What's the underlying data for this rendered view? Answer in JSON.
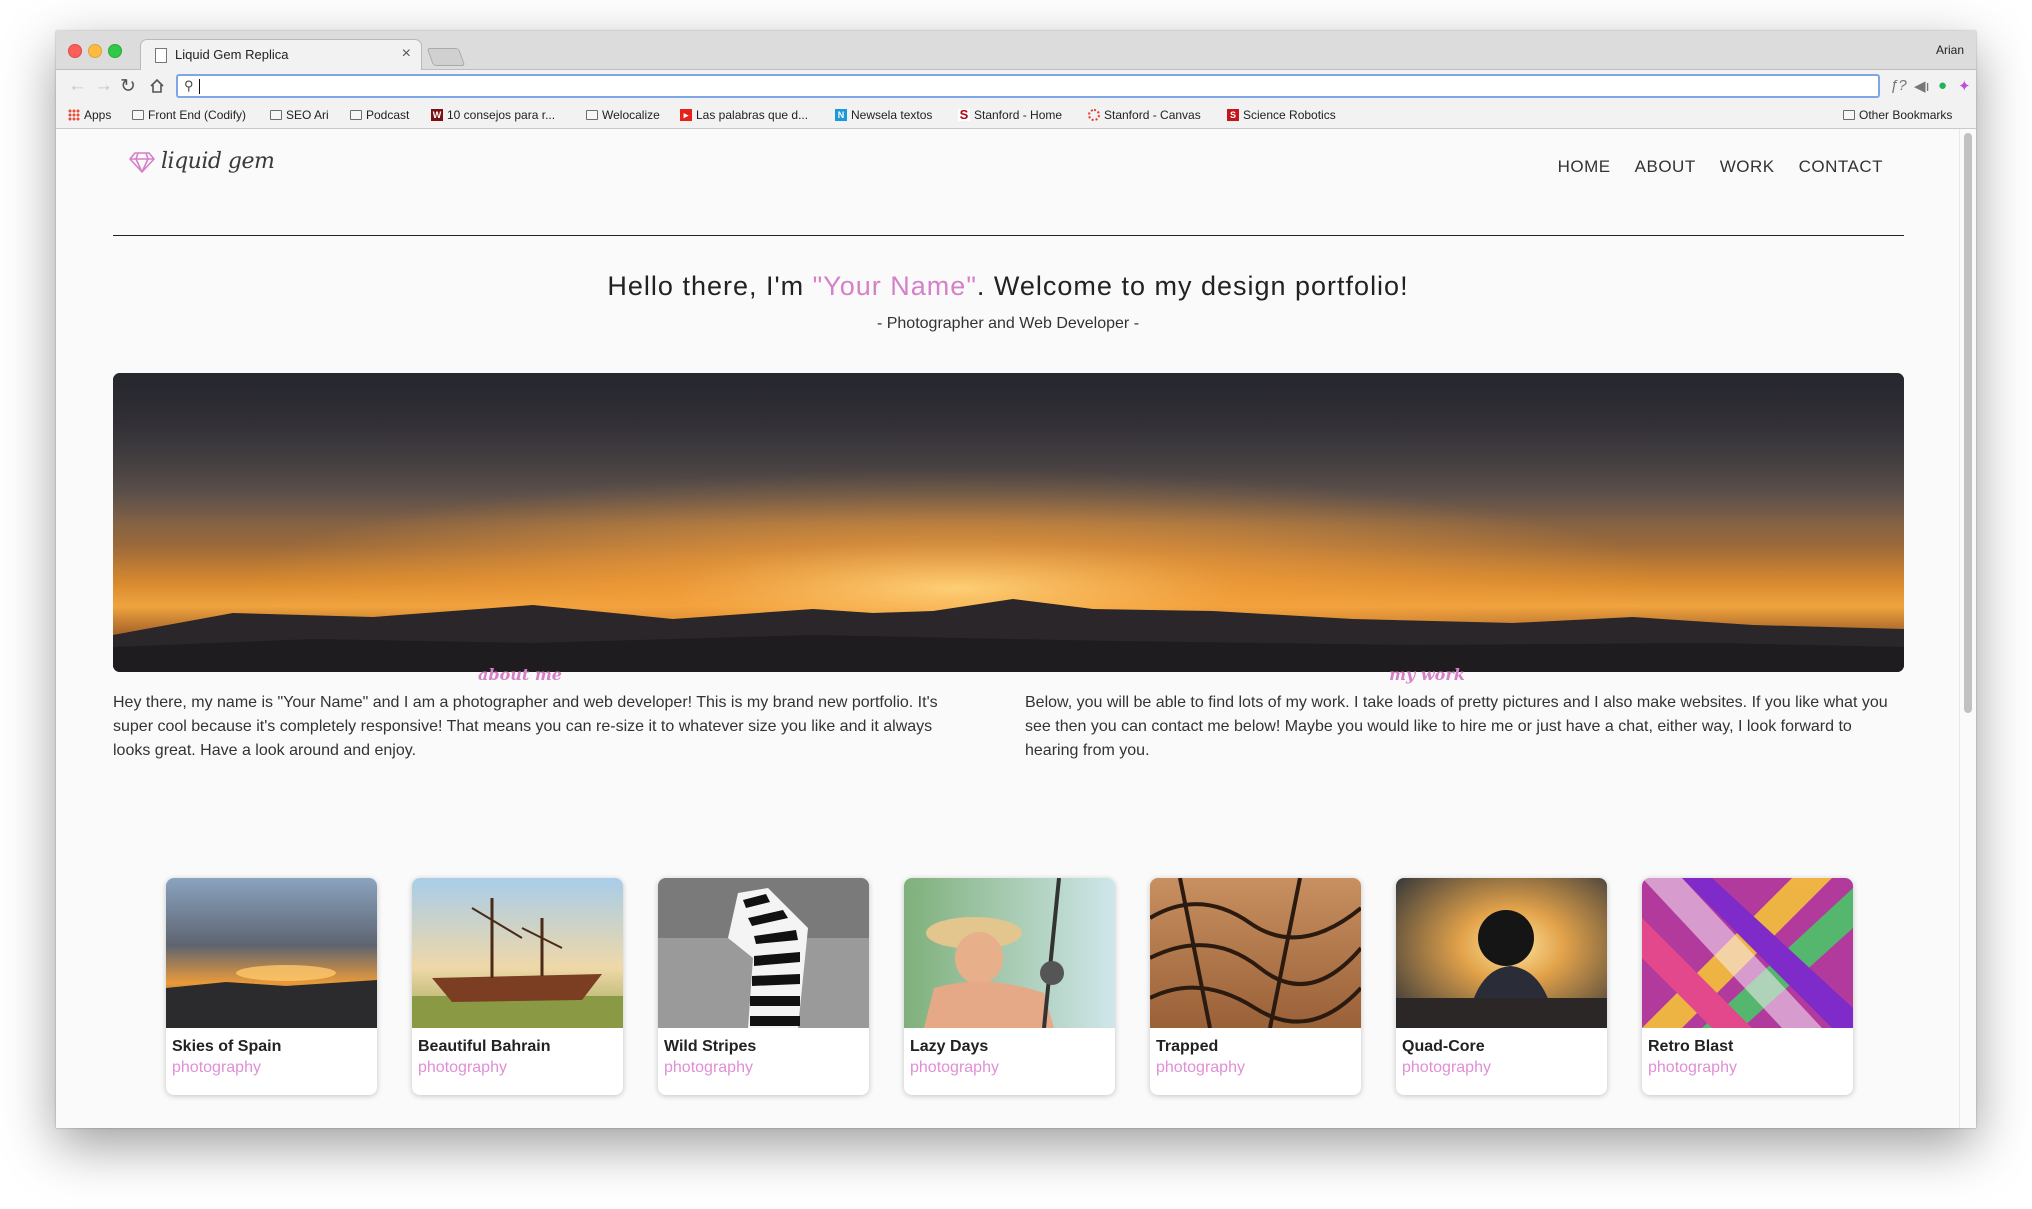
{
  "browser": {
    "tab_title": "Liquid Gem Replica",
    "tab_close": "×",
    "user": "Arian",
    "address_value": "",
    "bookmarks": [
      {
        "label": "Apps",
        "icon": "apps-grid-icon"
      },
      {
        "label": "Front End (Codify)",
        "icon": "folder-icon"
      },
      {
        "label": "SEO Ari",
        "icon": "folder-icon"
      },
      {
        "label": "Podcast",
        "icon": "folder-icon"
      },
      {
        "label": "10 consejos para r...",
        "icon": "w-site-icon"
      },
      {
        "label": "Welocalize",
        "icon": "folder-icon"
      },
      {
        "label": "Las palabras que d...",
        "icon": "youtube-icon"
      },
      {
        "label": "Newsela textos",
        "icon": "newsela-icon"
      },
      {
        "label": "Stanford - Home",
        "icon": "stanford-icon"
      },
      {
        "label": "Stanford - Canvas",
        "icon": "canvas-icon"
      },
      {
        "label": "Science Robotics",
        "icon": "science-icon"
      }
    ],
    "other_bookmarks": "Other Bookmarks"
  },
  "site": {
    "logo": "liquid gem",
    "nav": [
      "HOME",
      "ABOUT",
      "WORK",
      "CONTACT"
    ],
    "hero": {
      "prefix": "Hello there, I'm ",
      "name": "\"Your Name\"",
      "suffix": ". Welcome to my design portfolio!",
      "subtitle": "- Photographer and Web Developer -"
    },
    "about": {
      "title": "about me",
      "text": "Hey there, my name is \"Your Name\" and I am a photographer and web developer! This is my brand new portfolio. It's super cool because it's completely responsive! That means you can re-size it to whatever size you like and it always looks great. Have a look around and enjoy."
    },
    "work": {
      "title": "my work",
      "text": "Below, you will be able to find lots of my work. I take loads of pretty pictures and I also make websites. If you like what you see then you can contact me below! Maybe you would like to hire me or just have a chat, either way, I look forward to hearing from you."
    },
    "portfolio": [
      {
        "title": "Skies of Spain",
        "category": "photography"
      },
      {
        "title": "Beautiful Bahrain",
        "category": "photography"
      },
      {
        "title": "Wild Stripes",
        "category": "photography"
      },
      {
        "title": "Lazy Days",
        "category": "photography"
      },
      {
        "title": "Trapped",
        "category": "photography"
      },
      {
        "title": "Quad-Core",
        "category": "photography"
      },
      {
        "title": "Retro Blast",
        "category": "photography"
      }
    ]
  },
  "colors": {
    "accent": "#d580c7",
    "category": "#e08fd6",
    "text": "#333333"
  }
}
